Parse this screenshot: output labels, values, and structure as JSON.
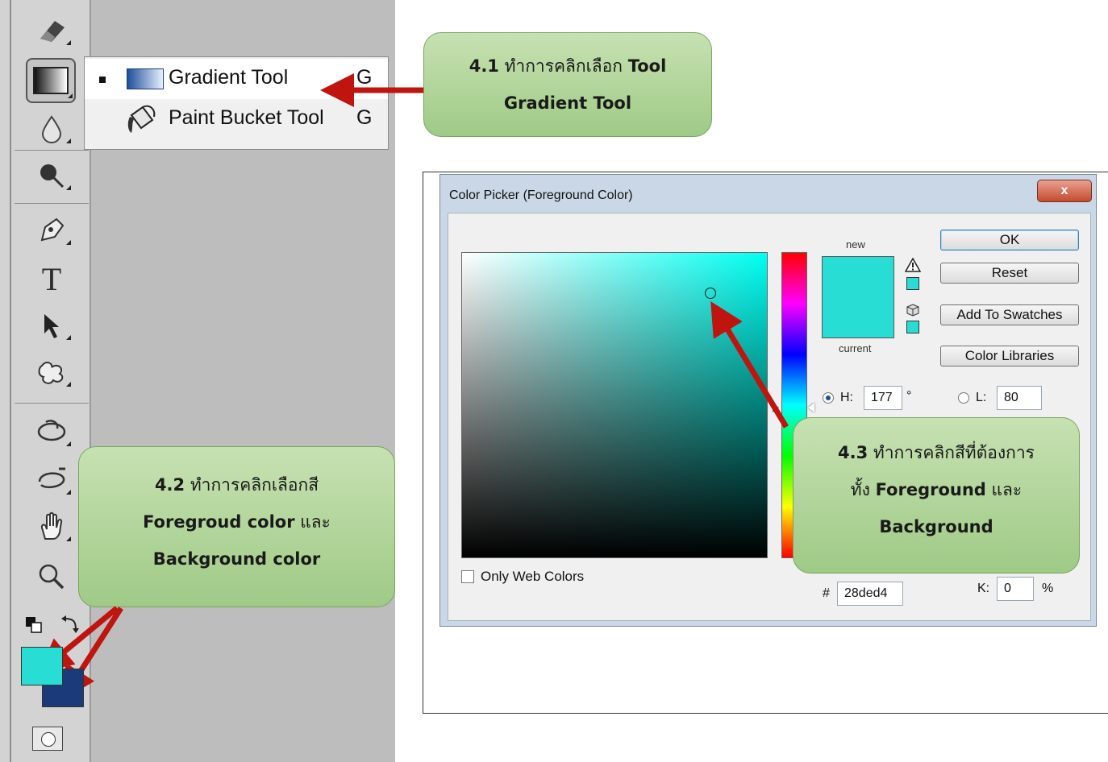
{
  "toolbar": {
    "tools": [
      "eraser-icon",
      "gradient-icon",
      "blur-icon",
      "dodge-icon",
      "pen-icon",
      "type-icon",
      "path-selection-icon",
      "custom-shape-icon",
      "3d-rotate-icon",
      "3d-orbit-icon",
      "hand-icon",
      "zoom-icon"
    ],
    "type_glyph": "T",
    "foreground_color": "#28ded4",
    "background_color": "#1b3a7a"
  },
  "flyout": {
    "items": [
      {
        "label": "Gradient Tool",
        "shortcut": "G",
        "active": true
      },
      {
        "label": "Paint Bucket Tool",
        "shortcut": "G",
        "active": false
      }
    ]
  },
  "callouts": {
    "c41": {
      "line1_bold": "4.1",
      "line1_text": " ทำการคลิกเลือก ",
      "line1_bold2": "Tool",
      "line2_bold": "Gradient Tool"
    },
    "c42": {
      "line1_bold": "4.2",
      "line1_text": " ทำการคลิกเลือกสี",
      "line2_bold": "Foregroud color",
      "line2_text": " และ",
      "line3_bold": "Background color"
    },
    "c43": {
      "line1_bold": "4.3",
      "line1_text": " ทำการคลิกสีที่ต้องการ",
      "line2_text": "ทั้ง ",
      "line2_bold": "Foreground",
      "line2_text2": " และ",
      "line3_bold": "Background"
    }
  },
  "dialog": {
    "title": "Color Picker (Foreground Color)",
    "close_glyph": "x",
    "new_label": "new",
    "current_label": "current",
    "new_color": "#28ded4",
    "buttons": {
      "ok": "OK",
      "reset": "Reset",
      "add_swatches": "Add To Swatches",
      "libraries": "Color Libraries"
    },
    "h_label": "H:",
    "h_value": "177",
    "h_unit": "°",
    "l_label": "L:",
    "l_value": "80",
    "hex_label": "#",
    "hex_value": "28ded4",
    "k_label": "K:",
    "k_value": "0",
    "k_unit": "%",
    "only_web_colors": "Only Web Colors"
  }
}
